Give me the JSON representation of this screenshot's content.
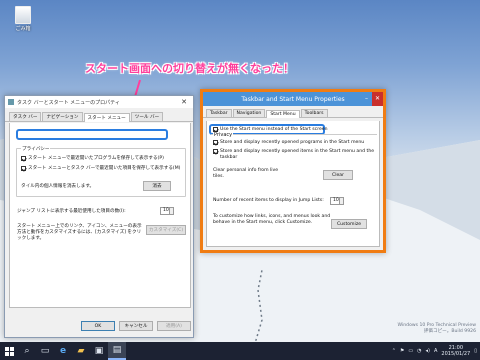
{
  "desktop": {
    "recycle_bin_label": "ごみ箱",
    "callout_text": "スタート画面への切り替えが無くなった！",
    "watermark_line1": "Windows 10 Pro Technical Preview",
    "watermark_line2": "評価コピー。Build 9926"
  },
  "jp_dialog": {
    "title": "タスク バーとスタート メニューのプロパティ",
    "tabs": [
      "タスク バー",
      "ナビゲーション",
      "スタート メニュー",
      "ツール バー"
    ],
    "privacy_label": "プライバシー",
    "check1": "スタート メニューで最近開いたプログラムを保存して表示する(P)",
    "check2": "スタート メニューとタスク バーで最近開いた項目を保存して表示する(M)",
    "tile_info": "タイル内の個人情報を消去します。",
    "clear_button": "消去",
    "jump_list_label": "ジャンプ リストに表示する最近使用した項目の数(I):",
    "jump_list_value": "10",
    "customize_text": "スタート メニュー上でのリンク、アイコン、メニューの表示方法と動作をカスタマイズするには、[カスタマイズ] をクリックします。",
    "customize_button": "カスタマイズ(C)",
    "ok_button": "OK",
    "cancel_button": "キャンセル",
    "apply_button": "適用(A)"
  },
  "en_dialog": {
    "title": "Taskbar and Start Menu Properties",
    "tabs": [
      "Taskbar",
      "Navigation",
      "Start Menu",
      "Toolbars"
    ],
    "use_start_menu": "Use the Start menu instead of the Start screen",
    "privacy_label": "Privacy",
    "check1": "Store and display recently opened programs in the Start menu",
    "check2_a": "Store and display recently opened items in the Start menu and the",
    "check2_b": "taskbar",
    "clear_info_a": "Clear personal info from live",
    "clear_info_b": "tiles.",
    "clear_button": "Clear",
    "recent_items_label": "Number of recent items to display in Jump Lists:",
    "recent_items_value": "10",
    "customize_text_a": "To customize how links, icons, and menus look and",
    "customize_text_b": "behave in the Start menu, click Customize.",
    "customize_button": "Customize"
  },
  "taskbar": {
    "time": "21:00",
    "date": "2015/01/27",
    "ime": "A"
  },
  "colors": {
    "highlight": "#2a7de0",
    "callout": "#ff3f9c",
    "english_border": "#f07c12"
  }
}
